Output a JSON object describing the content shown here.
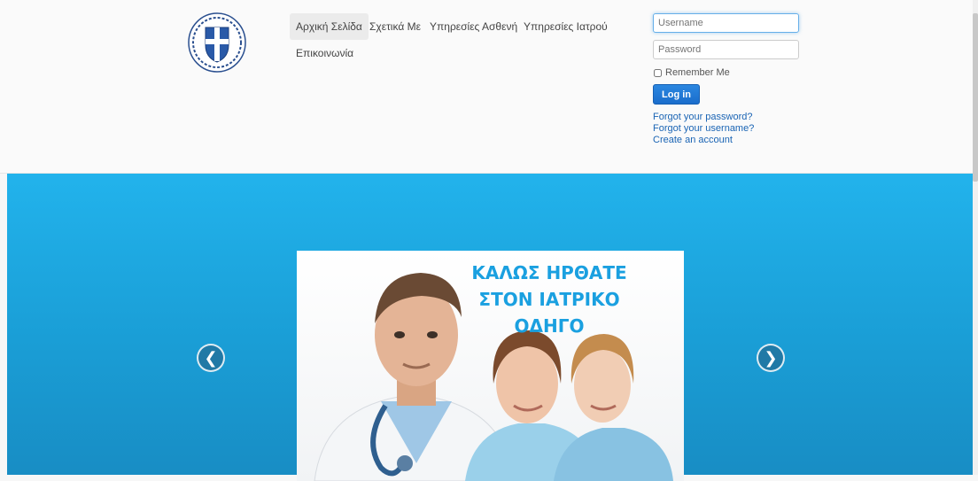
{
  "nav": {
    "items": [
      {
        "label": "Αρχική Σελίδα",
        "active": true
      },
      {
        "label": "Σχετικά Με"
      },
      {
        "label": "Υπηρεσίες Ασθενή"
      },
      {
        "label": "Υπηρεσίες Ιατρού"
      },
      {
        "label": "Επικοινωνία"
      }
    ]
  },
  "login": {
    "username_placeholder": "Username",
    "password_placeholder": "Password",
    "remember_label": "Remember Me",
    "login_button": "Log in",
    "links": [
      "Forgot your password?",
      "Forgot your username?",
      "Create an account"
    ]
  },
  "hero": {
    "title_lines": [
      "ΚΑΛΩΣ ΗΡΘΑΤΕ",
      "ΣΤΟΝ ΙΑΤΡΙΚΟ",
      "ΟΔΗΓΟ"
    ],
    "prev_glyph": "❮",
    "next_glyph": "❯"
  },
  "colors": {
    "accent": "#1a6dcc",
    "hero": "#1da8e4",
    "title": "#1aa0e0"
  }
}
